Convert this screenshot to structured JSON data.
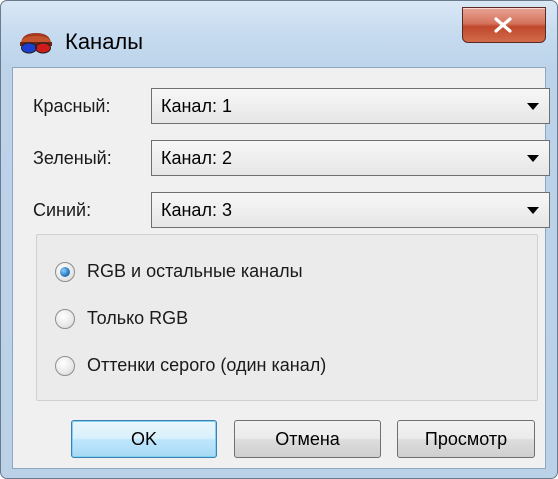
{
  "window": {
    "title": "Каналы"
  },
  "channels": [
    {
      "label": "Красный:",
      "value": "Канал: 1"
    },
    {
      "label": "Зеленый:",
      "value": "Канал: 2"
    },
    {
      "label": "Синий:",
      "value": "Канал: 3"
    }
  ],
  "mode_options": [
    {
      "label": "RGB и остальные каналы",
      "checked": true
    },
    {
      "label": "Только RGB",
      "checked": false
    },
    {
      "label": "Оттенки серого (один канал)",
      "checked": false
    }
  ],
  "buttons": {
    "ok": "OK",
    "cancel": "Отмена",
    "preview": "Просмотр"
  },
  "colors": {
    "accent": "#3c7fb1",
    "close_button": "#c0482c"
  }
}
